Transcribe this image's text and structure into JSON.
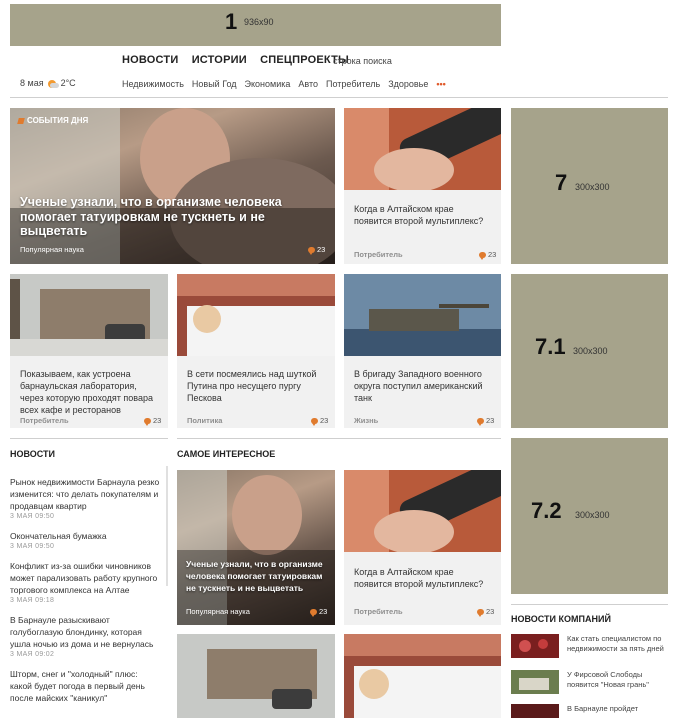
{
  "banner_top": {
    "number": "1",
    "size": "936x90"
  },
  "nav": {
    "main": [
      "НОВОСТИ",
      "ИСТОРИИ",
      "СПЕЦПРОЕКТЫ"
    ],
    "search_placeholder": "строка поиска",
    "date": "8 мая",
    "temperature": "2°C",
    "weather_icon": "partly-cloudy-icon",
    "sub": [
      "Недвижимость",
      "Новый Год",
      "Экономика",
      "Авто",
      "Потребитель",
      "Здоровье"
    ],
    "more": "•••"
  },
  "featured": {
    "tag": "СОБЫТИЯ ДНЯ",
    "title": "Ученые узнали, что в организме человека помогает татуировкам не тускнеть и не выцветать",
    "rubric": "Популярная наука",
    "comments": "23"
  },
  "cards": [
    {
      "title": "Когда в Алтайском крае появится второй мультиплекс?",
      "rubric": "Потребитель",
      "comments": "23"
    },
    {
      "title": "Показываем, как устроена барнаульская лаборатория, через которую проходят повара всех кафе и ресторанов",
      "rubric": "Потребитель",
      "comments": "23"
    },
    {
      "title": "В сети посмеялись над шуткой Путина про несущего пургу Пескова",
      "rubric": "Политика",
      "comments": "23"
    },
    {
      "title": "В бригаду Западного военного округа поступил американский танк",
      "rubric": "Жизнь",
      "comments": "23"
    }
  ],
  "side_banners": [
    {
      "number": "7",
      "size": "300x300"
    },
    {
      "number": "7.1",
      "size": "300x300"
    },
    {
      "number": "7.2",
      "size": "300x300"
    }
  ],
  "news": {
    "heading": "НОВОСТИ",
    "items": [
      {
        "title": "Рынок недвижимости Барнаула резко изменится: что делать покупателям и продавцам квартир",
        "date": "3 МАЯ 09:50"
      },
      {
        "title": "Окончательная бумажка",
        "date": "3 МАЯ 09:50"
      },
      {
        "title": "Конфликт из-за ошибки чиновников может парализовать работу крупного торгового комплекса на Алтае",
        "date": "3 МАЯ 09:18"
      },
      {
        "title": "В Барнауле разыскивают голубоглазую блондинку, которая ушла ночью из дома и не вернулась",
        "date": "3 МАЯ 09:02"
      },
      {
        "title": "Шторм, снег и \"холодный\" плюс: какой будет погода в первый день после майских \"каникул\"",
        "date": ""
      }
    ]
  },
  "interesting": {
    "heading": "САМОЕ ИНТЕРЕСНОЕ",
    "featured": {
      "title": "Ученые узнали, что в организме человека помогает татуировкам не тускнеть и не выцветать",
      "rubric": "Популярная наука",
      "comments": "23"
    },
    "card": {
      "title": "Когда в Алтайском крае появится второй мультиплекс?",
      "rubric": "Потребитель",
      "comments": "23"
    }
  },
  "companies": {
    "heading": "НОВОСТИ КОМПАНИЙ",
    "items": [
      {
        "title": "Как стать специалистом по недвижимости за пять дней"
      },
      {
        "title": "У Фирсовой Слободы появится \"Новая грань\""
      },
      {
        "title": "В Барнауле пройдет"
      }
    ]
  },
  "colors": {
    "banner": "#a6a38b",
    "accent": "#e07b2e",
    "card_bg": "#f1f1f1"
  }
}
